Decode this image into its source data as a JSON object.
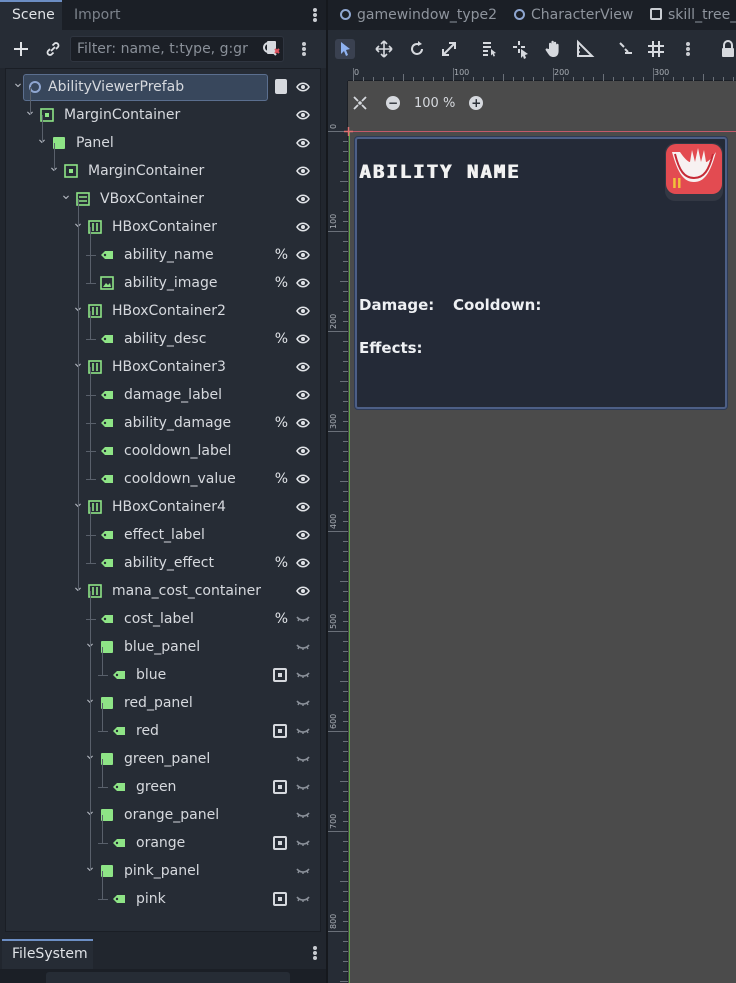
{
  "left_dock": {
    "tabs": [
      "Scene",
      "Import"
    ],
    "filter_placeholder": "Filter: name, t:type, g:gr"
  },
  "tree": [
    {
      "label": "AbilityViewerPrefab",
      "depth": 0,
      "icon": "node-ring-icon",
      "badge": "script",
      "selected": true
    },
    {
      "label": "MarginContainer",
      "depth": 1,
      "icon": "margin-container-icon",
      "badge": ""
    },
    {
      "label": "Panel",
      "depth": 2,
      "icon": "panel-icon",
      "badge": ""
    },
    {
      "label": "MarginContainer",
      "depth": 3,
      "icon": "margin-container-icon",
      "badge": ""
    },
    {
      "label": "VBoxContainer",
      "depth": 4,
      "icon": "vbox-icon",
      "badge": ""
    },
    {
      "label": "HBoxContainer",
      "depth": 5,
      "icon": "hbox-icon",
      "badge": ""
    },
    {
      "label": "ability_name",
      "depth": 6,
      "icon": "label-icon",
      "badge": "%"
    },
    {
      "label": "ability_image",
      "depth": 6,
      "icon": "texture-rect-icon",
      "badge": "%"
    },
    {
      "label": "HBoxContainer2",
      "depth": 5,
      "icon": "hbox-icon",
      "badge": ""
    },
    {
      "label": "ability_desc",
      "depth": 6,
      "icon": "label-icon",
      "badge": "%"
    },
    {
      "label": "HBoxContainer3",
      "depth": 5,
      "icon": "hbox-icon",
      "badge": ""
    },
    {
      "label": "damage_label",
      "depth": 6,
      "icon": "label-icon",
      "badge": ""
    },
    {
      "label": "ability_damage",
      "depth": 6,
      "icon": "label-icon",
      "badge": "%"
    },
    {
      "label": "cooldown_label",
      "depth": 6,
      "icon": "label-icon",
      "badge": ""
    },
    {
      "label": "cooldown_value",
      "depth": 6,
      "icon": "label-icon",
      "badge": "%"
    },
    {
      "label": "HBoxContainer4",
      "depth": 5,
      "icon": "hbox-icon",
      "badge": ""
    },
    {
      "label": "effect_label",
      "depth": 6,
      "icon": "label-icon",
      "badge": ""
    },
    {
      "label": "ability_effect",
      "depth": 6,
      "icon": "label-icon",
      "badge": "%"
    },
    {
      "label": "mana_cost_container",
      "depth": 5,
      "icon": "hbox-icon",
      "badge": ""
    },
    {
      "label": "cost_label",
      "depth": 6,
      "icon": "label-icon",
      "badge": "%",
      "hidden": true
    },
    {
      "label": "blue_panel",
      "depth": 6,
      "icon": "panel-icon",
      "badge": "",
      "hidden": true
    },
    {
      "label": "blue",
      "depth": 7,
      "icon": "label-icon",
      "badge": "unique",
      "hidden": true
    },
    {
      "label": "red_panel",
      "depth": 6,
      "icon": "panel-icon",
      "badge": "",
      "hidden": true
    },
    {
      "label": "red",
      "depth": 7,
      "icon": "label-icon",
      "badge": "unique",
      "hidden": true
    },
    {
      "label": "green_panel",
      "depth": 6,
      "icon": "panel-icon",
      "badge": "",
      "hidden": true
    },
    {
      "label": "green",
      "depth": 7,
      "icon": "label-icon",
      "badge": "unique",
      "hidden": true
    },
    {
      "label": "orange_panel",
      "depth": 6,
      "icon": "panel-icon",
      "badge": "",
      "hidden": true
    },
    {
      "label": "orange",
      "depth": 7,
      "icon": "label-icon",
      "badge": "unique",
      "hidden": true
    },
    {
      "label": "pink_panel",
      "depth": 6,
      "icon": "panel-icon",
      "badge": "",
      "hidden": true
    },
    {
      "label": "pink",
      "depth": 7,
      "icon": "label-icon",
      "badge": "unique",
      "hidden": true
    }
  ],
  "filesystem": {
    "tab": "FileSystem"
  },
  "editor": {
    "tabs": [
      {
        "label": "gamewindow_type2",
        "icon": "scene-dot-icon"
      },
      {
        "label": "CharacterView",
        "icon": "scene-dot-icon"
      },
      {
        "label": "skill_tree_b",
        "icon": "scene-check-icon"
      }
    ],
    "zoom": "100 %",
    "ruler_top": [
      "0",
      "100",
      "200",
      "300"
    ],
    "ruler_left": [
      "0",
      "100",
      "200",
      "300",
      "400",
      "500",
      "600",
      "700",
      "800"
    ]
  },
  "card": {
    "title": "ABILITY NAME",
    "damage_label": "Damage:",
    "cooldown_label": "Cooldown:",
    "effects_label": "Effects:"
  },
  "colors": {
    "accent": "#6c8ec4",
    "node_green": "#8ee486",
    "selected_row": "#38475c",
    "card_bg": "#242a37",
    "image_red": "#e34b51"
  }
}
